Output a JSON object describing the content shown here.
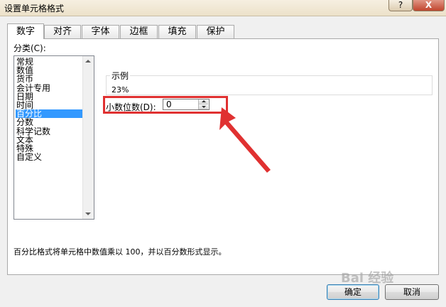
{
  "window": {
    "title": "设置单元格格式",
    "help_label": "?",
    "close_label": "X"
  },
  "tabs": [
    {
      "label": "数字",
      "active": true
    },
    {
      "label": "对齐"
    },
    {
      "label": "字体"
    },
    {
      "label": "边框"
    },
    {
      "label": "填充"
    },
    {
      "label": "保护"
    }
  ],
  "category": {
    "label": "分类(C):",
    "items": [
      "常规",
      "数值",
      "货币",
      "会计专用",
      "日期",
      "时间",
      "百分比",
      "分数",
      "科学记数",
      "文本",
      "特殊",
      "自定义"
    ],
    "selected_index": 6
  },
  "sample": {
    "legend": "示例",
    "value": "23%"
  },
  "decimals": {
    "label": "小数位数(D):",
    "value": "0"
  },
  "description": "百分比格式将单元格中数值乘以 100，并以百分数形式显示。",
  "buttons": {
    "ok": "确定",
    "cancel": "取消"
  },
  "watermark": "Bai 经验",
  "colors": {
    "selection": "#3399ff",
    "annotation": "#e03131"
  }
}
